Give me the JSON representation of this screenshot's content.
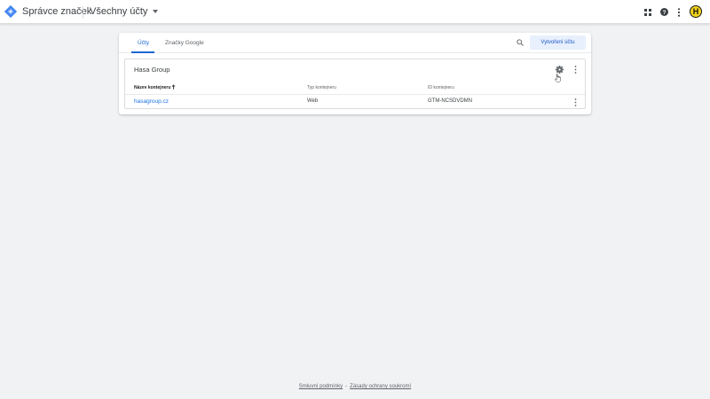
{
  "app": {
    "title": "Správce značek",
    "account_selector": "Všechny účty",
    "brand_color": "#4285f4"
  },
  "top_icons": [
    "apps-icon",
    "help-icon",
    "more-vert-icon"
  ],
  "avatar": {
    "letter": "H",
    "color": "#f2d21b"
  },
  "tabs": [
    {
      "label": "Účty",
      "active": true
    },
    {
      "label": "Značky Google",
      "active": false
    }
  ],
  "toolbar": {
    "search_icon": "search-icon",
    "create_label": "Vytvoření účtu"
  },
  "account": {
    "name": "Hasa Group",
    "columns": {
      "name": "Název kontejneru",
      "type": "Typ kontejneru",
      "id": "ID kontejneru"
    },
    "rows": [
      {
        "name": "hasagroup.cz",
        "type": "Web",
        "id": "GTM-NCSDVDMN"
      }
    ]
  },
  "footer": {
    "terms": "Smluvní podmínky",
    "separator": "-",
    "privacy": "Zásady ochrany soukromí"
  }
}
